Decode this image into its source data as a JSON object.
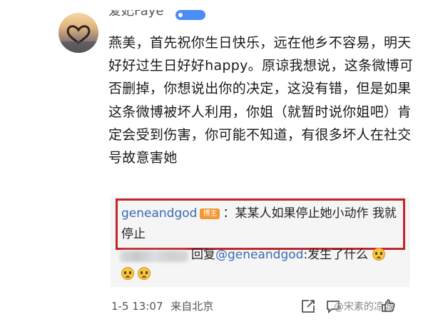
{
  "post": {
    "username": "爱妃Faye",
    "text": "燕美，首先祝你生日快乐，远在他乡不容易，明天好好过生日好好happy。原谅我想说，这条微博可否删掉，你想说出你的决定，这没有错，但是如果这条微博被坏人利用，你姐（就暂时说你姐吧）肯定会受到伤害，你可能不知道，有很多坏人在社交号故意害她"
  },
  "replies": [
    {
      "username": "geneandgod",
      "badge": "博主",
      "text": "：某某人如果停止她小动作 我就停止"
    },
    {
      "prefix": "回复",
      "mention": "@geneandgod",
      "text": ":发生了什么"
    }
  ],
  "meta": {
    "time": "1-5 13:07",
    "location": "来自北京"
  },
  "watermark": "@宋素的凉城",
  "colors": {
    "highlight_border": "#c0262b",
    "link": "#3a6bb0",
    "author_badge": "#f29733"
  }
}
